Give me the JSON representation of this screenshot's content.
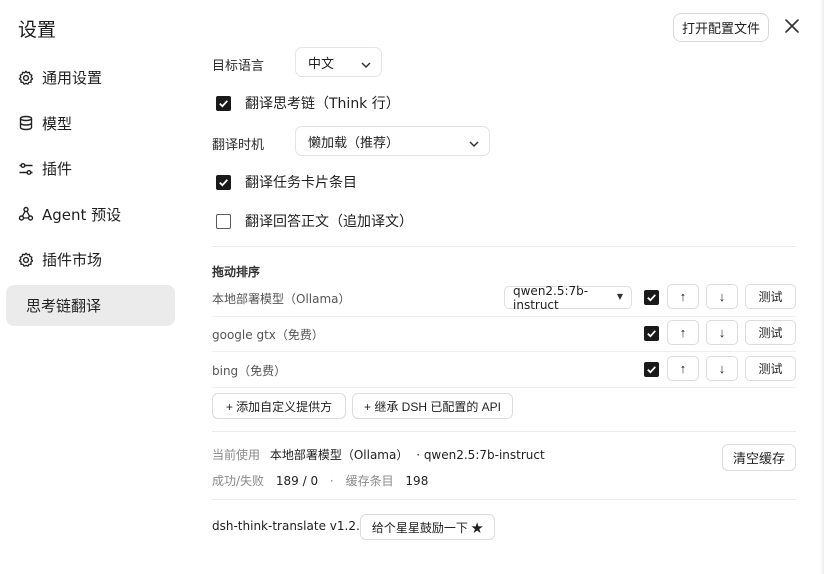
{
  "window": {
    "title": "设置",
    "open_config_label": "打开配置文件"
  },
  "sidebar": {
    "items": [
      {
        "label": "通用设置",
        "icon": "gear-icon"
      },
      {
        "label": "模型",
        "icon": "database-icon"
      },
      {
        "label": "插件",
        "icon": "sliders-icon"
      },
      {
        "label": "Agent 预设",
        "icon": "agent-icon"
      },
      {
        "label": "插件市场",
        "icon": "gear-icon"
      },
      {
        "label": "思考链翻译",
        "active": true
      }
    ]
  },
  "settings": {
    "target_language_label": "目标语言",
    "target_language_value": "中文",
    "translate_think_label": "翻译思考链（Think 行）",
    "translate_think_checked": true,
    "timing_label": "翻译时机",
    "timing_value": "懒加载（推荐）",
    "translate_task_label": "翻译任务卡片条目",
    "translate_task_checked": true,
    "translate_answer_label": "翻译回答正文（追加译文）",
    "translate_answer_checked": false
  },
  "providers": {
    "section_title": "拖动排序",
    "up_label": "↑",
    "down_label": "↓",
    "test_label": "测试",
    "rows": [
      {
        "name": "本地部署模型（Ollama）",
        "model": "qwen2.5:7b-instruct",
        "enabled": true
      },
      {
        "name": "google gtx（免费）",
        "enabled": true
      },
      {
        "name": "bing（免费）",
        "enabled": true
      }
    ],
    "add_custom_label": "+ 添加自定义提供方",
    "inherit_label": "+ 继承 DSH 已配置的 API"
  },
  "status": {
    "current_label": "当前使用",
    "current_provider": "本地部署模型（Ollama）",
    "current_model": "· qwen2.5:7b-instruct",
    "success_fail_label": "成功/失败",
    "success_fail_value": "189 / 0",
    "dot": "·",
    "cache_label": "缓存条目",
    "cache_value": "198",
    "clear_cache_label": "清空缓存"
  },
  "footer": {
    "version": "dsh-think-translate v1.2.0",
    "star_label": "给个星星鼓励一下 ★"
  }
}
